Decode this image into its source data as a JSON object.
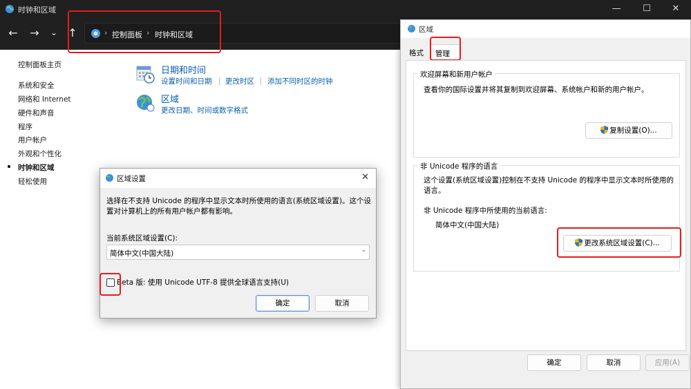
{
  "window": {
    "title": "时钟和区域"
  },
  "address": {
    "crumbs": [
      "控制面板",
      "时钟和区域"
    ]
  },
  "sidebar": {
    "items": [
      {
        "label": "控制面板主页",
        "active": false
      },
      {
        "label": "系统和安全",
        "active": false
      },
      {
        "label": "网络和 Internet",
        "active": false
      },
      {
        "label": "硬件和声音",
        "active": false
      },
      {
        "label": "程序",
        "active": false
      },
      {
        "label": "用户帐户",
        "active": false
      },
      {
        "label": "外观和个性化",
        "active": false
      },
      {
        "label": "时钟和区域",
        "active": true
      },
      {
        "label": "轻松使用",
        "active": false
      }
    ]
  },
  "categories": [
    {
      "title": "日期和时间",
      "links": [
        "设置时间和日期",
        "更改时区",
        "添加不同时区的时钟"
      ]
    },
    {
      "title": "区域",
      "links": [
        "更改日期、时间或数字格式"
      ]
    }
  ],
  "region_dialog": {
    "title": "区域",
    "tabs": [
      "格式",
      "管理"
    ],
    "group1": {
      "title": "欢迎屏幕和新用户帐户",
      "text": "查看你的国际设置并将其复制到欢迎屏幕、系统帐户和新的用户帐户。",
      "button": "复制设置(O)..."
    },
    "group2": {
      "title": "非 Unicode 程序的语言",
      "text": "这个设置(系统区域设置)控制在不支持 Unicode 的程序中显示文本时所使用的语言。",
      "current_label": "非 Unicode 程序中所使用的当前语言:",
      "current_value": "简体中文(中国大陆)",
      "button": "更改系统区域设置(C)..."
    },
    "ok": "确定",
    "cancel": "取消",
    "apply": "应用(A)"
  },
  "region_settings": {
    "title": "区域设置",
    "description": "选择在不支持 Unicode 的程序中显示文本时所使用的语言(系统区域设置)。这个设置对计算机上的所有用户帐户都有影响。",
    "current_label": "当前系统区域设置(C):",
    "current_value": "简体中文(中国大陆)",
    "beta_label": "Beta 版: 使用 Unicode UTF-8 提供全球语言支持(U)",
    "beta_checked": false,
    "ok": "确定",
    "cancel": "取消"
  },
  "colors": {
    "link": "#0a5fb0",
    "highlight": "#e51c1c",
    "titlebar": "#202020"
  }
}
